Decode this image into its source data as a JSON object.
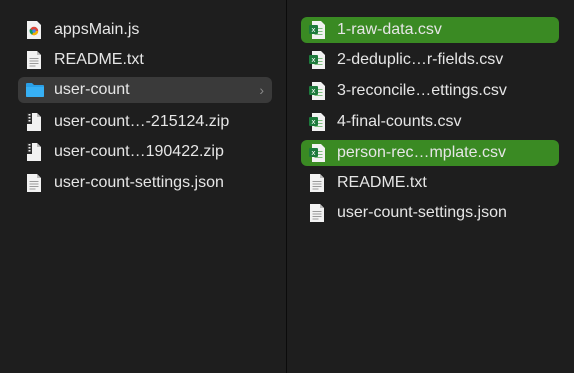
{
  "left_column": {
    "items": [
      {
        "label": "appsMain.js",
        "icon": "js-file-icon"
      },
      {
        "label": "README.txt",
        "icon": "text-file-icon"
      },
      {
        "label": "user-count",
        "icon": "folder-icon",
        "has_children": true,
        "chevron": "›"
      },
      {
        "label": "user-count…-215124.zip",
        "icon": "zip-file-icon"
      },
      {
        "label": "user-count…190422.zip",
        "icon": "zip-file-icon"
      },
      {
        "label": "user-count-settings.json",
        "icon": "json-file-icon"
      }
    ]
  },
  "right_column": {
    "items": [
      {
        "label": "1-raw-data.csv",
        "icon": "csv-file-icon",
        "selected": true
      },
      {
        "label": "2-deduplic…r-fields.csv",
        "icon": "csv-file-icon"
      },
      {
        "label": "3-reconcile…ettings.csv",
        "icon": "csv-file-icon"
      },
      {
        "label": "4-final-counts.csv",
        "icon": "csv-file-icon"
      },
      {
        "label": "person-rec…mplate.csv",
        "icon": "csv-file-icon",
        "selected": true
      },
      {
        "label": "README.txt",
        "icon": "text-file-icon"
      },
      {
        "label": "user-count-settings.json",
        "icon": "json-file-icon"
      }
    ]
  },
  "colors": {
    "background": "#1e1e1e",
    "selection_green": "#3a8a23",
    "folder_highlight": "#3a3a3a",
    "folder_blue": "#2aa0e8",
    "text": "#e6e6e6"
  }
}
